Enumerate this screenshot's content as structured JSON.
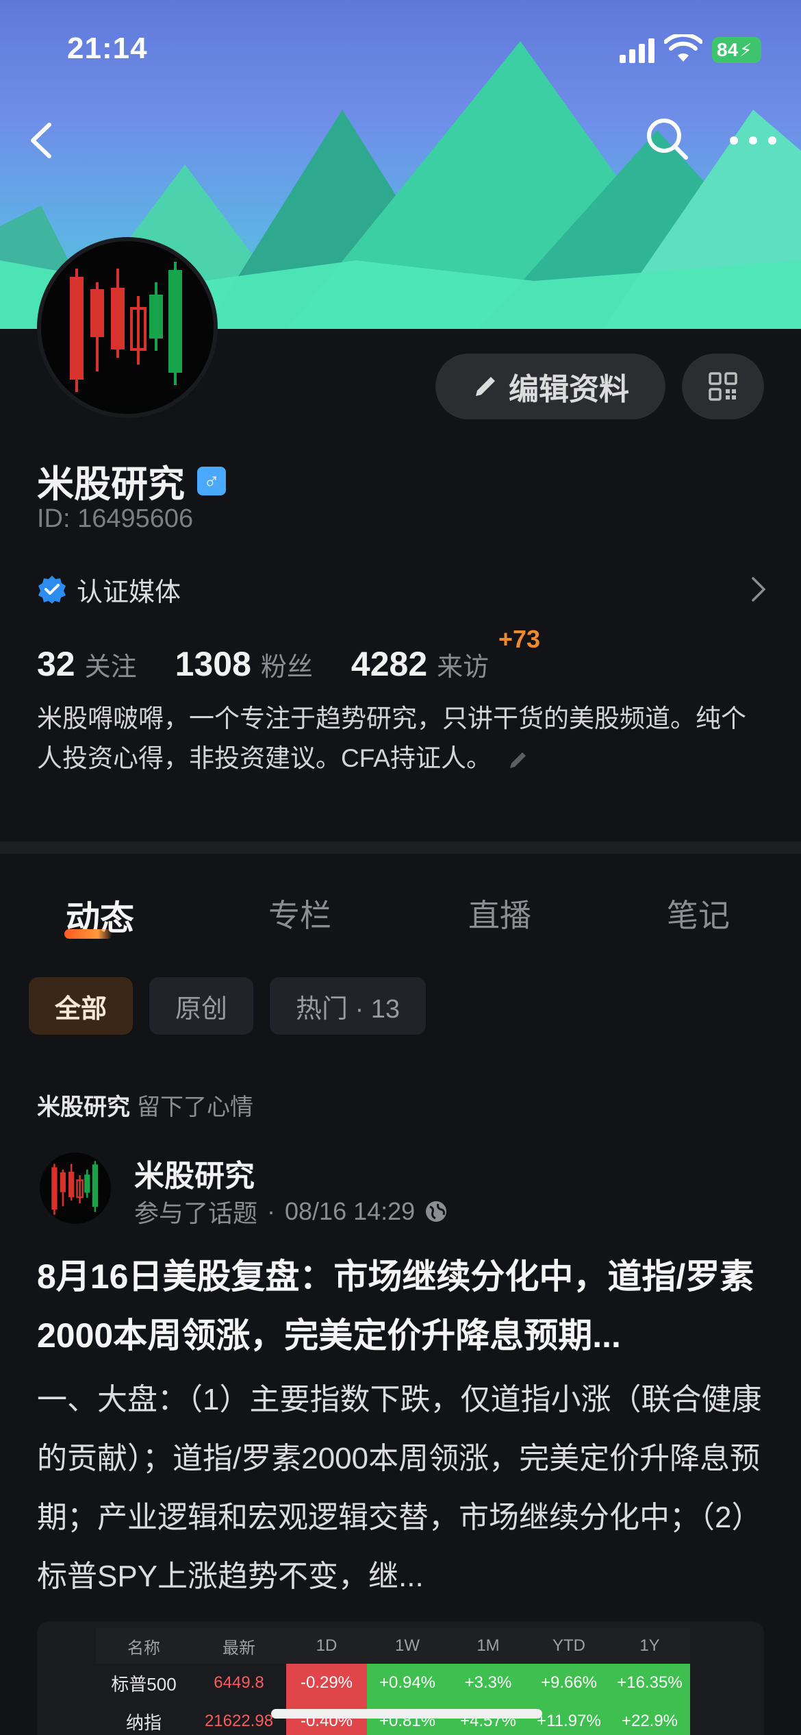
{
  "status_bar": {
    "time": "21:14",
    "battery": "84"
  },
  "nav": {
    "back": "back-icon",
    "search": "search-icon",
    "more": "more-icon"
  },
  "profile": {
    "name": "米股研究",
    "gender_symbol": "♂",
    "id_text": "ID: 16495606",
    "edit_label": "编辑资料",
    "verify_label": "认证媒体",
    "stats": [
      {
        "num": "32",
        "label": "关注"
      },
      {
        "num": "1308",
        "label": "粉丝"
      },
      {
        "num": "4282",
        "label": "来访"
      }
    ],
    "visit_delta": "+73",
    "bio": "米股嘚啵嘚，一个专注于趋势研究，只讲干货的美股频道。纯个人投资心得，非投资建议。CFA持证人。"
  },
  "tabs": [
    "动态",
    "专栏",
    "直播",
    "笔记"
  ],
  "filters": [
    "全部",
    "原创",
    "热门 · 13"
  ],
  "feed": {
    "meta_who": "米股研究",
    "meta_action": "留下了心情",
    "author": "米股研究",
    "sub_action": "参与了话题",
    "sub_time": "08/16 14:29",
    "title": "8月16日美股复盘：市场继续分化中，道指/罗素2000本周领涨，完美定价升降息预期...",
    "body": "一、大盘：（1）主要指数下跌，仅道指小涨（联合健康的贡献）；道指/罗素2000本周领涨，完美定价升降息预期；产业逻辑和宏观逻辑交替，市场继续分化中；（2）标普SPY上涨趋势不变，继..."
  },
  "table": {
    "headers": [
      "名称",
      "最新",
      "1D",
      "1W",
      "1M",
      "YTD",
      "1Y"
    ],
    "rows": [
      [
        "标普500",
        "6449.8",
        "-0.29%",
        "+0.94%",
        "+3.3%",
        "+9.66%",
        "+16.35%"
      ],
      [
        "纳指",
        "21622.98",
        "-0.40%",
        "+0.81%",
        "+4.57%",
        "+11.97%",
        "+22.9%"
      ]
    ]
  },
  "colors": {
    "accent_orange": "#f08a2e",
    "up_green": "#3fbf4f",
    "down_red": "#e0454a",
    "background": "#121316"
  }
}
